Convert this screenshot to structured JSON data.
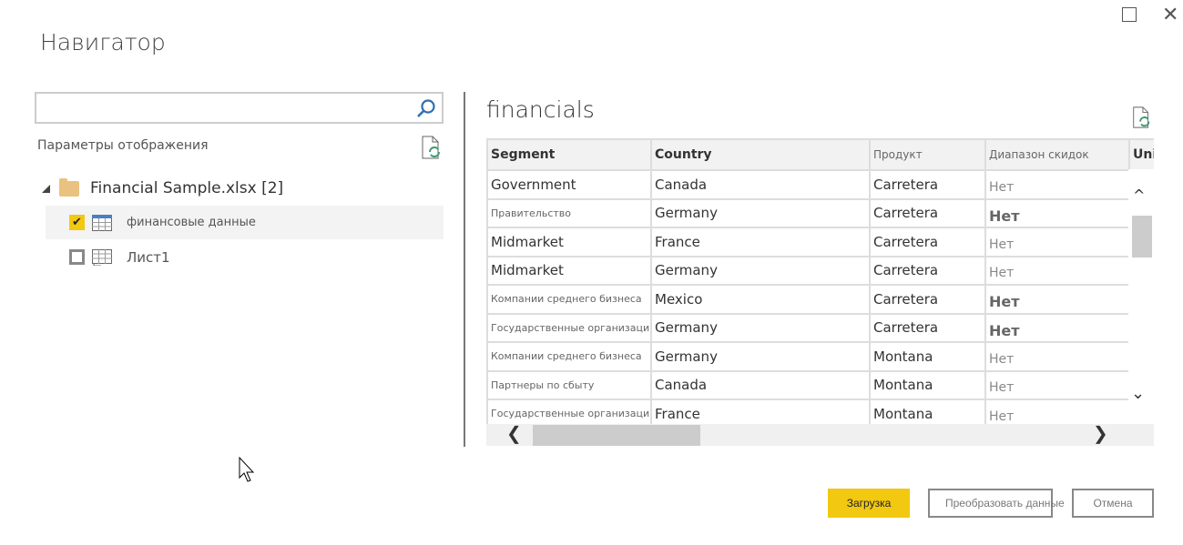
{
  "window": {
    "title": "Навигатор",
    "maximize_icon": "square-icon",
    "close_icon": "x-icon"
  },
  "left": {
    "search": {
      "value": "",
      "placeholder": ""
    },
    "display_options": "Параметры отображения",
    "tree": {
      "root": {
        "label": "Financial Sample.xlsx [2]",
        "expanded": true
      },
      "items": [
        {
          "label": "финансовые данные",
          "checked": true,
          "selected": true
        },
        {
          "label": "Лист1",
          "checked": false,
          "selected": false
        }
      ]
    }
  },
  "preview": {
    "title": "financials",
    "columns": [
      "Segment",
      "Country",
      "Продукт",
      "Диапазон скидок",
      "Uni"
    ],
    "rows": [
      {
        "cells": [
          "Government",
          "Canada",
          "Carretera",
          "Нет"
        ],
        "small": false,
        "big": false
      },
      {
        "cells": [
          "Правительство",
          "Germany",
          "Carretera",
          "Нет"
        ],
        "small": true,
        "big": true
      },
      {
        "cells": [
          "Midmarket",
          "France",
          "Carretera",
          "Нет"
        ],
        "small": false,
        "big": false
      },
      {
        "cells": [
          "Midmarket",
          "Germany",
          "Carretera",
          "Нет"
        ],
        "small": false,
        "big": false
      },
      {
        "cells": [
          "Компании среднего бизнеса",
          "Mexico",
          "Carretera",
          "Нет"
        ],
        "small": true,
        "big": true
      },
      {
        "cells": [
          "Государственные организации",
          "Germany",
          "Carretera",
          "Нет"
        ],
        "small": true,
        "big": true
      },
      {
        "cells": [
          "Компании среднего бизнеса",
          "Germany",
          "Montana",
          "Нет"
        ],
        "small": true,
        "big": false
      },
      {
        "cells": [
          "Партнеры по сбыту",
          "Canada",
          "Montana",
          "Нет"
        ],
        "small": true,
        "big": false
      },
      {
        "cells": [
          "Государственные организации",
          "France",
          "Montana",
          "Нет"
        ],
        "small": true,
        "big": false
      }
    ]
  },
  "buttons": {
    "load": "Загрузка",
    "transform": "Преобразовать данные",
    "cancel": "Отмена"
  },
  "colors": {
    "accent": "#f2c811",
    "folder": "#e8c27e",
    "refresh": "#3c9a6e",
    "search_icon": "#2f6db3"
  }
}
